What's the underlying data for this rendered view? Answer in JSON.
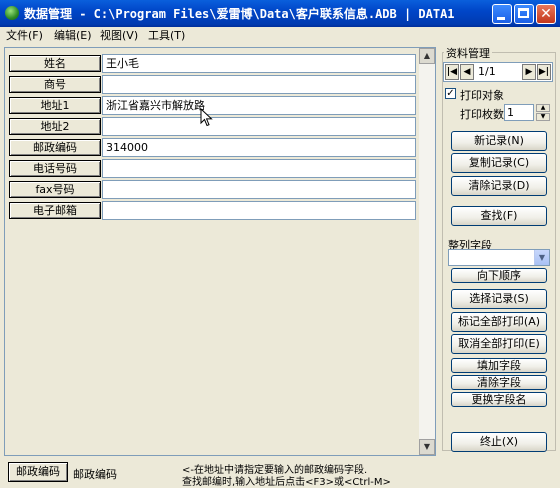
{
  "window": {
    "title": "数据管理 - C:\\Program Files\\爱雷博\\Data\\客户联系信息.ADB | DATA1"
  },
  "menu": [
    "文件(F)",
    "编辑(E)",
    "视图(V)",
    "工具(T)"
  ],
  "fields": [
    {
      "label": "姓名",
      "value": "王小毛"
    },
    {
      "label": "商号",
      "value": ""
    },
    {
      "label": "地址1",
      "value": "浙江省嘉兴市解放路"
    },
    {
      "label": "地址2",
      "value": ""
    },
    {
      "label": "邮政编码",
      "value": "314000"
    },
    {
      "label": "电话号码",
      "value": ""
    },
    {
      "label": "fax号码",
      "value": ""
    },
    {
      "label": "电子邮箱",
      "value": ""
    }
  ],
  "panel": {
    "title": "资料管理",
    "record_nav": "1/1",
    "print_target_label": "打印对象",
    "print_target_checked": true,
    "print_copies_label": "打印枚数",
    "print_copies_value": "1",
    "new_record": "新记录(N)",
    "copy_record": "复制记录(C)",
    "delete_record": "清除记录(D)",
    "find": "查找(F)",
    "sort_field_label": "整列字段",
    "sort_field_value": "",
    "sort_order": "向下顺序",
    "select_record": "选择记录(S)",
    "mark_all_print": "标记全部打印(A)",
    "unmark_all_print": "取消全部打印(E)",
    "add_field": "填加字段",
    "remove_field": "清除字段",
    "rename_field": "更换字段名",
    "exit": "终止(X)"
  },
  "status": {
    "button": "邮政编码",
    "field": "邮政编码",
    "hint_line1": "<-在地址中请指定要输入的邮政编码字段.",
    "hint_line2": "查找邮编时,输入地址后点击<F3>或<Ctrl-M>"
  }
}
